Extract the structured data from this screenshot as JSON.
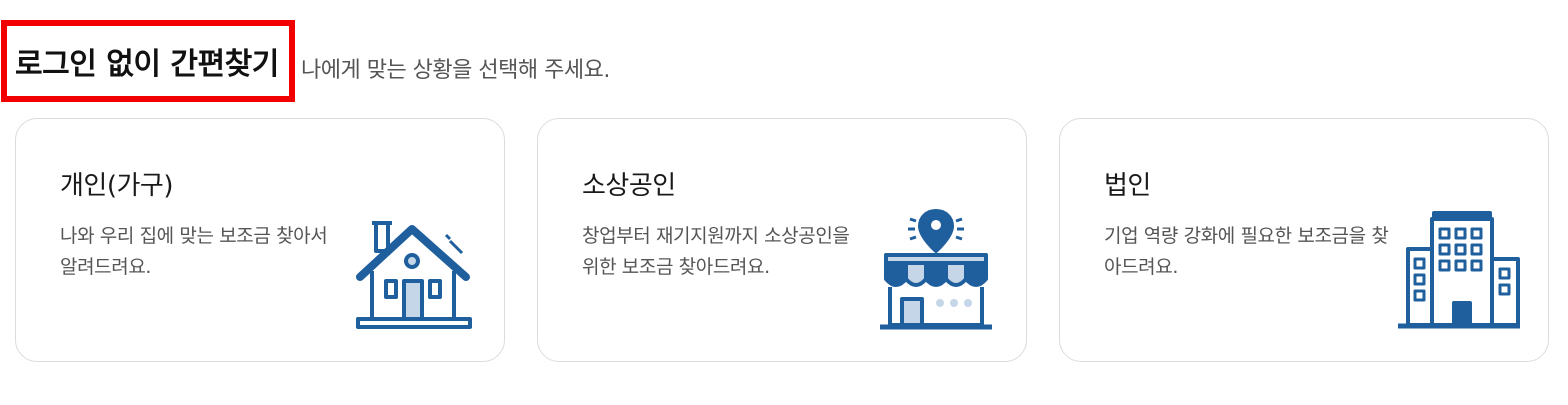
{
  "header": {
    "title": "로그인 없이 간편찾기",
    "subtitle": "나에게 맞는 상황을 선택해 주세요."
  },
  "cards": [
    {
      "title": "개인(가구)",
      "description": "나와 우리 집에 맞는 보조금 찾아서 알려드려요.",
      "icon": "house-icon"
    },
    {
      "title": "소상공인",
      "description": "창업부터 재기지원까지 소상공인을 위한 보조금 찾아드려요.",
      "icon": "store-icon"
    },
    {
      "title": "법인",
      "description": "기업 역량 강화에 필요한 보조금을 찾아드려요.",
      "icon": "building-icon"
    }
  ],
  "colors": {
    "icon_dark": "#1f5f9e",
    "icon_light": "#c5d6e8",
    "highlight_border": "#f20000"
  }
}
